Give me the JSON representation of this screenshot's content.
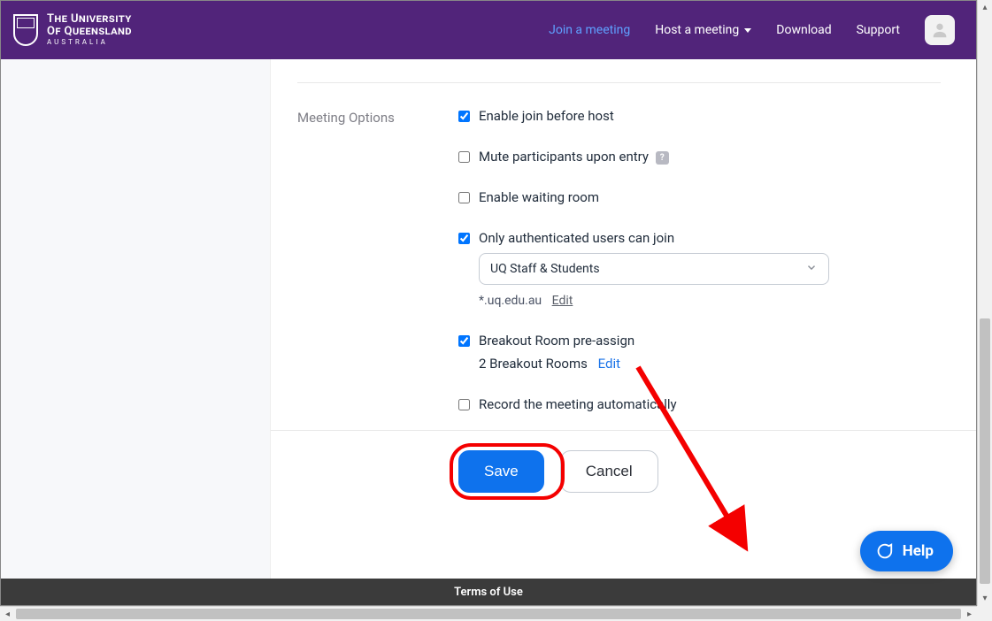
{
  "header": {
    "uni_line1": "The University",
    "uni_line2": "Of Queensland",
    "uni_line3": "AUSTRALIA",
    "nav": {
      "join": "Join a meeting",
      "host": "Host a meeting",
      "download": "Download",
      "support": "Support"
    }
  },
  "section": {
    "label": "Meeting Options",
    "options": {
      "join_before_host": "Enable join before host",
      "mute_on_entry": "Mute participants upon entry",
      "waiting_room": "Enable waiting room",
      "auth_only": "Only authenticated users can join",
      "auth_select": "UQ Staff & Students",
      "auth_domain": "*.uq.edu.au",
      "auth_edit": "Edit",
      "breakout": "Breakout Room pre-assign",
      "breakout_count": "2 Breakout Rooms",
      "breakout_edit": "Edit",
      "record_auto": "Record the meeting automatically"
    }
  },
  "buttons": {
    "save": "Save",
    "cancel": "Cancel"
  },
  "footer": {
    "terms": "Terms of Use"
  },
  "help": {
    "label": "Help"
  }
}
